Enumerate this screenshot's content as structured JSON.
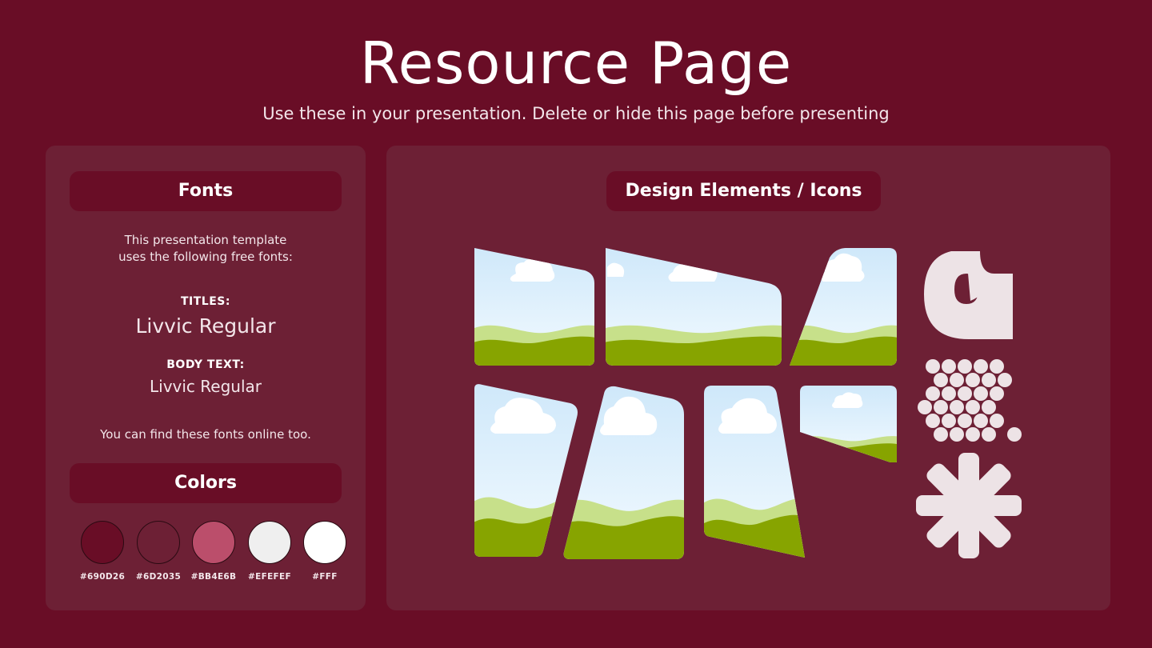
{
  "header": {
    "title": "Resource Page",
    "subtitle": "Use these in your presentation. Delete or hide this page before presenting"
  },
  "fonts_panel": {
    "heading": "Fonts",
    "intro_line1": "This presentation template",
    "intro_line2": "uses the following free fonts:",
    "titles_label": "TITLES:",
    "titles_font": "Livvic Regular",
    "body_label": "BODY TEXT:",
    "body_font": "Livvic Regular",
    "footnote": "You can find these fonts online too."
  },
  "colors_panel": {
    "heading": "Colors",
    "swatches": [
      {
        "hex": "#690D26",
        "label": "#690D26"
      },
      {
        "hex": "#6D2035",
        "label": "#6D2035"
      },
      {
        "hex": "#BB4E6B",
        "label": "#BB4E6B"
      },
      {
        "hex": "#EFEFEF",
        "label": "#EFEFEF"
      },
      {
        "hex": "#FFFFFF",
        "label": "#FFF"
      }
    ]
  },
  "design_panel": {
    "heading": "Design Elements / Icons",
    "icons": [
      "c-shape-icon",
      "wave-pattern-icon",
      "asterisk-icon"
    ]
  }
}
